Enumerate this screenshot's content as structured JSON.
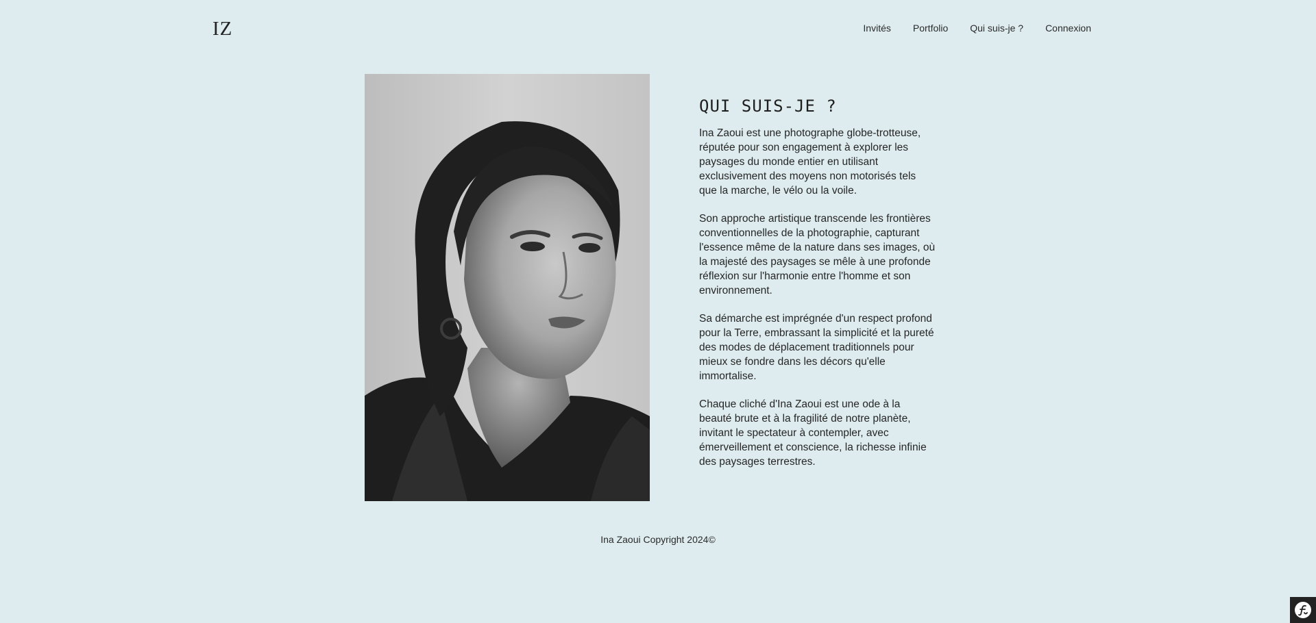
{
  "header": {
    "logo": "IZ",
    "nav": [
      {
        "label": "Invités"
      },
      {
        "label": "Portfolio"
      },
      {
        "label": "Qui suis-je ?"
      },
      {
        "label": "Connexion"
      }
    ]
  },
  "about": {
    "title": "QUI SUIS-JE ?",
    "paragraphs": [
      "Ina Zaoui est une photographe globe-trotteuse, réputée pour son engagement à explorer les paysages du monde entier en utilisant exclusivement des moyens non motorisés tels que la marche, le vélo ou la voile.",
      "Son approche artistique transcende les frontières conventionnelles de la photographie, capturant l'essence même de la nature dans ses images, où la majesté des paysages se mêle à une profonde réflexion sur l'harmonie entre l'homme et son environnement.",
      "Sa démarche est imprégnée d'un respect profond pour la Terre, embrassant la simplicité et la pureté des modes de déplacement traditionnels pour mieux se fondre dans les décors qu'elle immortalise.",
      "Chaque cliché d'Ina Zaoui est une ode à la beauté brute et à la fragilité de notre planète, invitant le spectateur à contempler, avec émerveillement et conscience, la richesse infinie des paysages terrestres."
    ]
  },
  "footer": {
    "copyright": "Ina Zaoui Copyright 2024©"
  },
  "colors": {
    "background": "#deecef",
    "text": "#222222"
  },
  "icons": {
    "debug_toolbar": "symfony-logo-icon"
  }
}
